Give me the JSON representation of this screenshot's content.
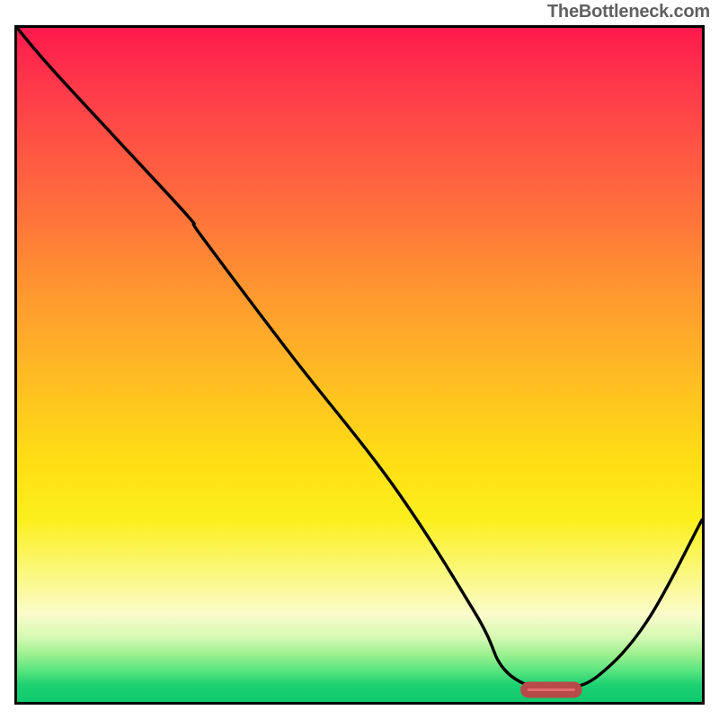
{
  "watermark": "TheBottleneck.com",
  "chart_data": {
    "type": "line",
    "title": "",
    "xlabel": "",
    "ylabel": "",
    "xlim": [
      0,
      100
    ],
    "ylim": [
      0,
      100
    ],
    "grid": false,
    "series": [
      {
        "name": "bottleneck-curve",
        "x": [
          0,
          5,
          15,
          25,
          27,
          40,
          55,
          67,
          71,
          76,
          80,
          85,
          92,
          100
        ],
        "y": [
          100,
          94,
          83,
          72,
          69,
          51.5,
          32,
          13,
          5,
          2,
          2,
          4,
          12,
          27
        ]
      }
    ],
    "optimum_marker": {
      "x_start": 74,
      "x_end": 82,
      "y": 1.8
    },
    "background_gradient": {
      "stops": [
        {
          "pct": 0,
          "color": "#ff1a4d"
        },
        {
          "pct": 40,
          "color": "#ff9a2f"
        },
        {
          "pct": 73,
          "color": "#fcef1e"
        },
        {
          "pct": 90,
          "color": "#d4f9b3"
        },
        {
          "pct": 100,
          "color": "#0fc96e"
        }
      ]
    }
  }
}
